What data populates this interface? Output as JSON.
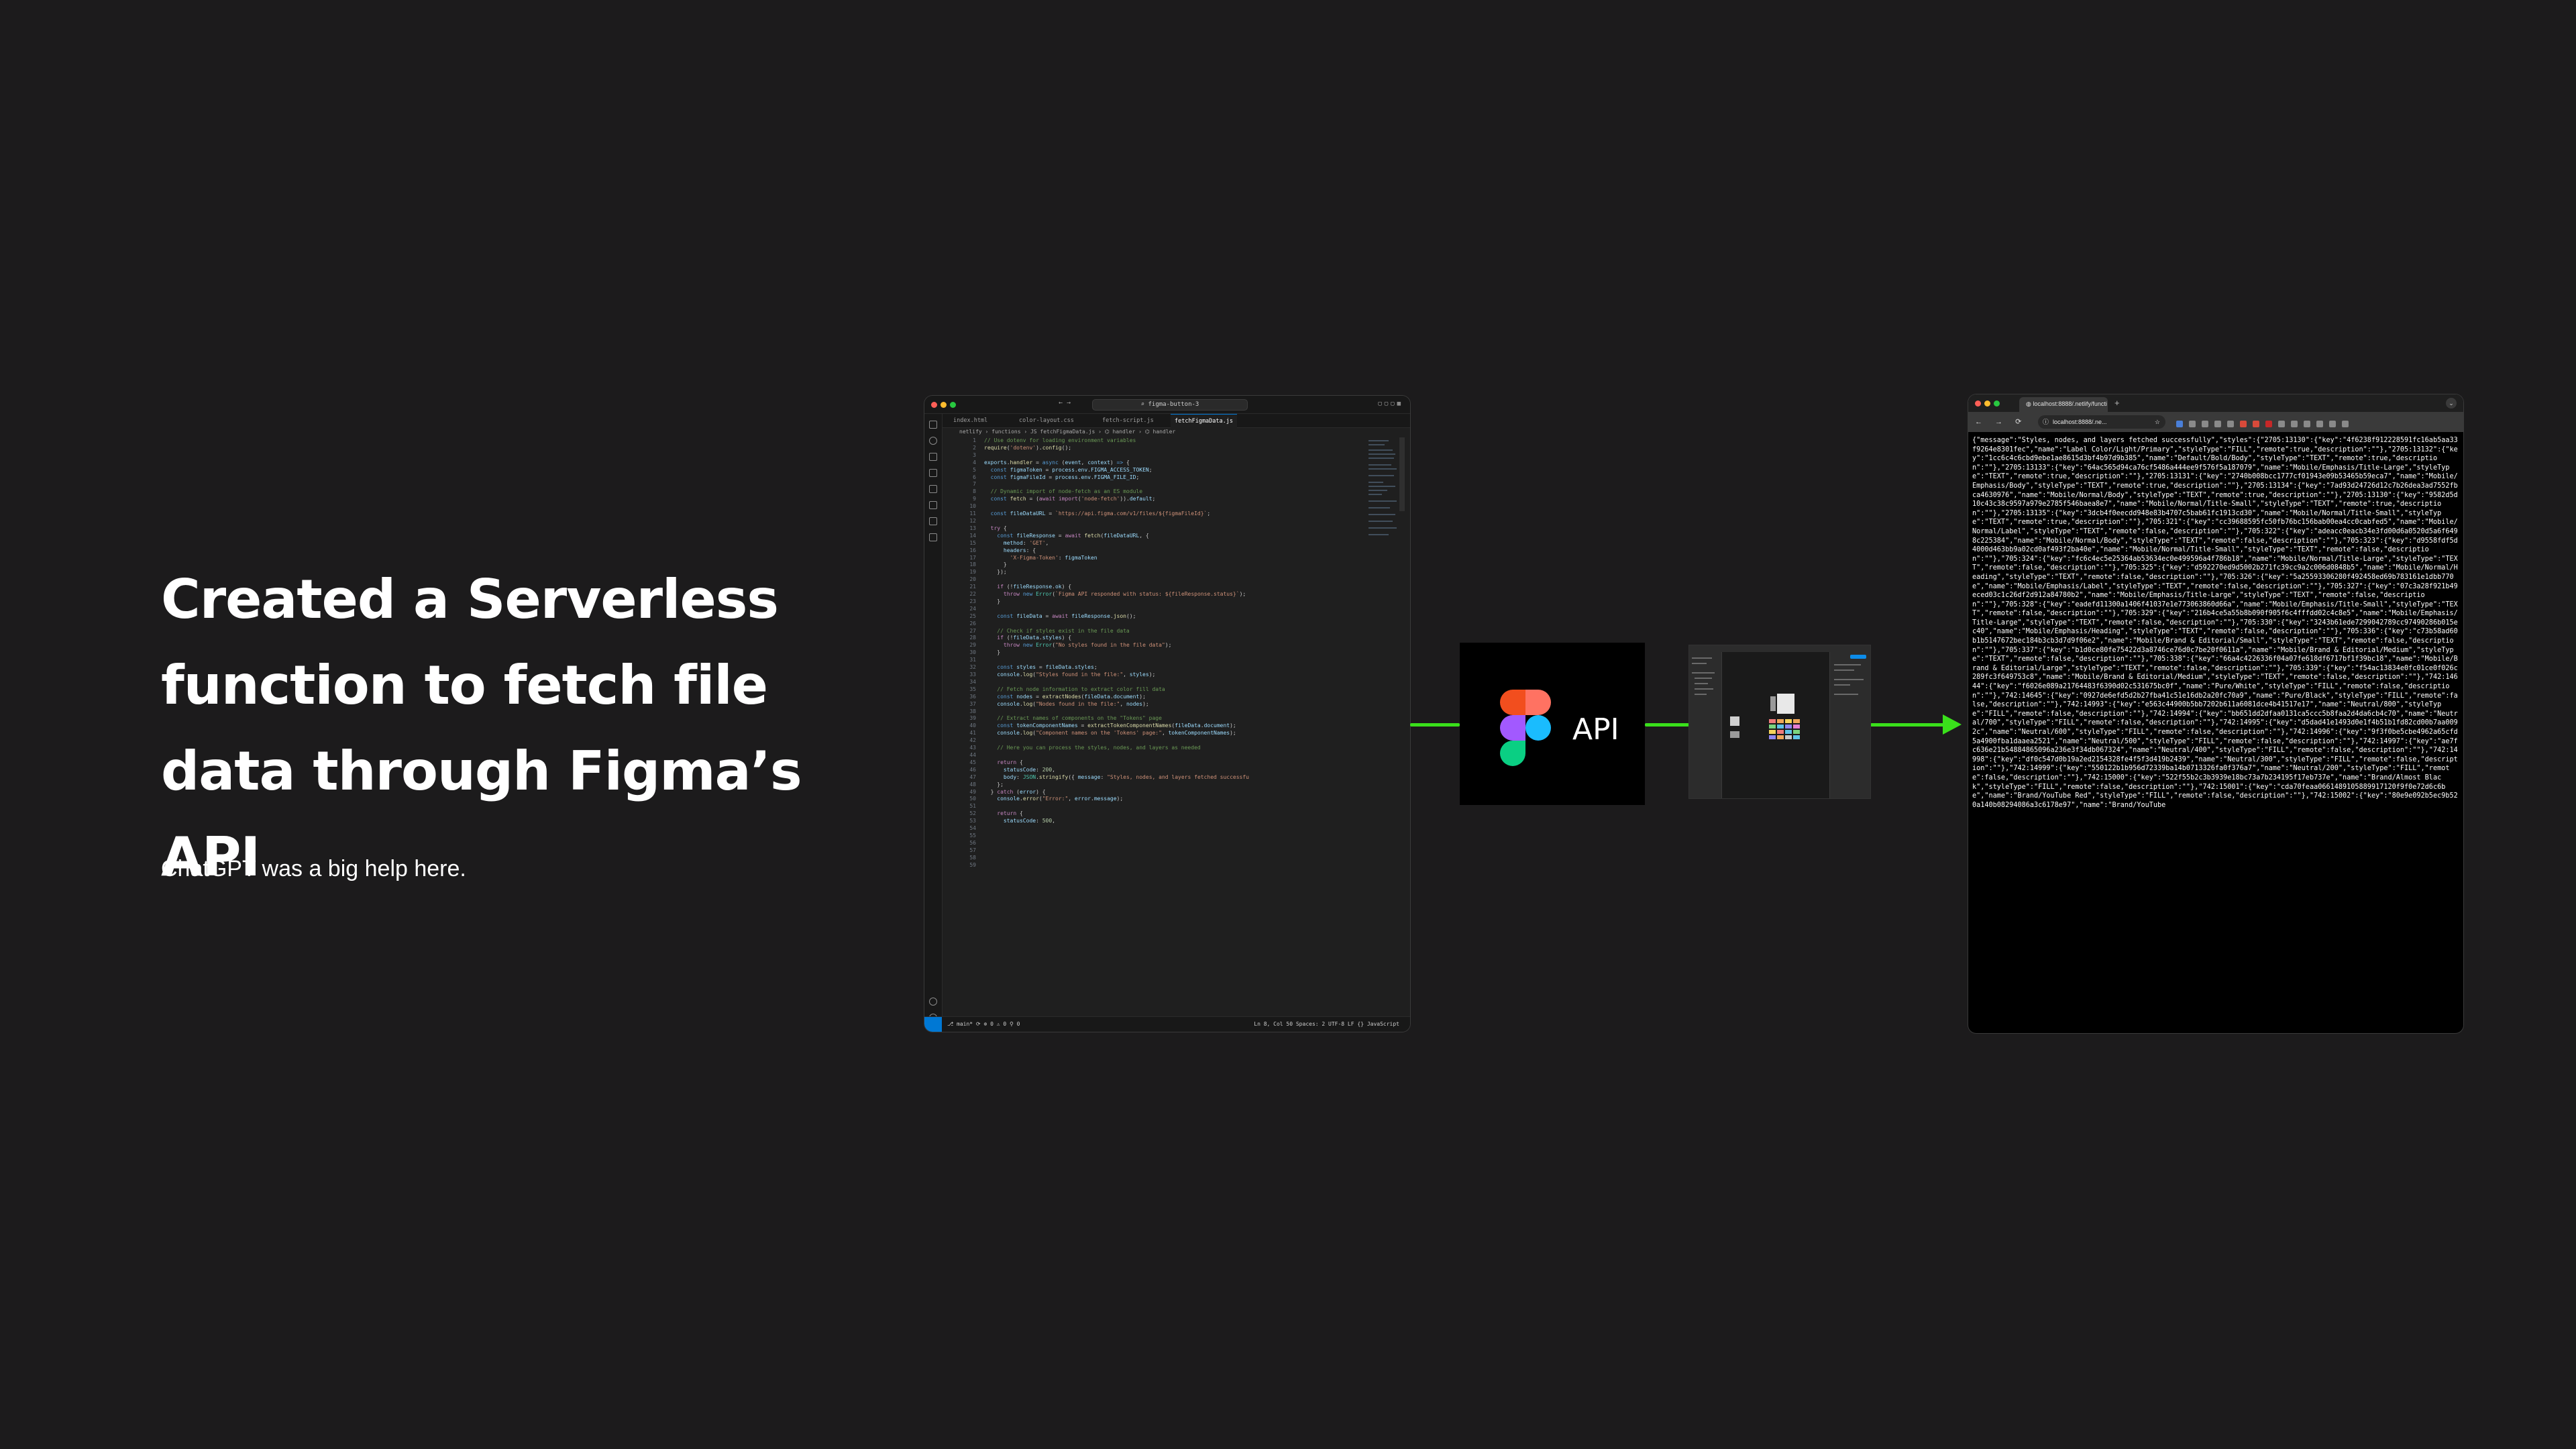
{
  "slide": {
    "title": "Created a Serverless function to fetch file data through Figma’s API",
    "subtitle": "ChatGPT was a big help here."
  },
  "vscode": {
    "search": "figma-button-3",
    "tabs": [
      "index.html",
      "color-layout.css",
      "fetch-script.js",
      "fetchFigmaData.js"
    ],
    "breadcrumb": "netlify › functions › JS fetchFigmaData.js › ⌬ handler › ⌬ handler",
    "line_numbers": "1\n2\n3\n4\n5\n6\n7\n8\n9\n10\n11\n12\n13\n14\n15\n16\n17\n18\n19\n20\n21\n22\n23\n24\n25\n26\n27\n28\n29\n30\n31\n32\n33\n34\n35\n36\n37\n38\n39\n40\n41\n42\n43\n44\n45\n46\n47\n48\n49\n50\n51\n52\n53\n54\n55\n56\n57\n58\n59",
    "status_left": "⎇ main*  ⟳  ⊗ 0 ⚠ 0  ⚲ 0",
    "status_right": "Ln 8, Col 50   Spaces: 2   UTF-8   LF   {} JavaScript"
  },
  "api_box": {
    "label": "API",
    "logo_colors": [
      "#f24e1e",
      "#ff7262",
      "#a259ff",
      "#1abcfe",
      "#0acf83"
    ]
  },
  "browser": {
    "tab_title": "localhost:8888/.netlify/functi",
    "url": "localhost:8888/.ne...",
    "json_output": "{\"message\":\"Styles, nodes, and layers fetched successfully\",\"styles\":{\"2705:13130\":{\"key\":\"4f6238f912228591fc16ab5aa33f9264e8301fec\",\"name\":\"Label Color/Light/Primary\",\"styleType\":\"FILL\",\"remote\":true,\"description\":\"\"},\"2705:13132\":{\"key\":\"1cc6c4c6cbd9ebe1ae8615d3bf4b97d9b385\",\"name\":\"Default/Bold/Body\",\"styleType\":\"TEXT\",\"remote\":true,\"description\":\"\"},\"2705:13133\":{\"key\":\"64ac565d94ca76cf5486a444ee9f576f5a187079\",\"name\":\"Mobile/Emphasis/Title-Large\",\"styleType\":\"TEXT\",\"remote\":true,\"description\":\"\"},\"2705:13131\":{\"key\":\"2740b008bcc1777cf01943e09b53465b59eca7\",\"name\":\"Mobile/Emphasis/Body\",\"styleType\":\"TEXT\",\"remote\":true,\"description\":\"\"},\"2705:13134\":{\"key\":\"7ad93d24726d12c7b26dea3ad7552fbca4630976\",\"name\":\"Mobile/Normal/Body\",\"styleType\":\"TEXT\",\"remote\":true,\"description\":\"\"},\"2705:13130\":{\"key\":\"9582d5d10c43c38c9597a979e2785f546baea8e7\",\"name\":\"Mobile/Normal/Title-Small\",\"styleType\":\"TEXT\",\"remote\":true,\"description\":\"\"},\"2705:13135\":{\"key\":\"3dcb4f0eecdd948e83b4707c5bab61fc1913cd30\",\"name\":\"Mobile/Normal/Title-Small\",\"styleType\":\"TEXT\",\"remote\":true,\"description\":\"\"},\"705:321\":{\"key\":\"cc39688595fc50fb76bc156bab00ea4cc0cabfed5\",\"name\":\"Mobile/Normal/Label\",\"styleType\":\"TEXT\",\"remote\":false,\"description\":\"\"},\"705:322\":{\"key\":\"adeacc0eacb34e3fd00d6a0520d5a6f6498c225384\",\"name\":\"Mobile/Normal/Body\",\"styleType\":\"TEXT\",\"remote\":false,\"description\":\"\"},\"705:323\":{\"key\":\"d9558fdf5d4000d463bb9a02cd0af493f2ba40e\",\"name\":\"Mobile/Normal/Title-Small\",\"styleType\":\"TEXT\",\"remote\":false,\"description\":\"\"},\"705:324\":{\"key\":\"fc6c4ec5e25364ab53634ec0e499596a4f786b18\",\"name\":\"Mobile/Normal/Title-Large\",\"styleType\":\"TEXT\",\"remote\":false,\"description\":\"\"},\"705:325\":{\"key\":\"d592270ed9d5002b271fc39cc9a2c006d0848b5\",\"name\":\"Mobile/Normal/Heading\",\"styleType\":\"TEXT\",\"remote\":false,\"description\":\"\"},\"705:326\":{\"key\":\"5a25593306280f492458ed69b783161e1dbb770e\",\"name\":\"Mobile/Emphasis/Label\",\"styleType\":\"TEXT\",\"remote\":false,\"description\":\"\"},\"705:327\":{\"key\":\"07c3a28f921b49eced03c1c26df2d912a84780b2\",\"name\":\"Mobile/Emphasis/Title-Large\",\"styleType\":\"TEXT\",\"remote\":false,\"description\":\"\"},\"705:328\":{\"key\":\"eadefd11300a1406f41037e1e773063860d66a\",\"name\":\"Mobile/Emphasis/Title-Small\",\"styleType\":\"TEXT\",\"remote\":false,\"description\":\"\"},\"705:329\":{\"key\":\"216b4ce5a55b8b090f905f6c4fffdd02c4c8e5\",\"name\":\"Mobile/Emphasis/Title-Large\",\"styleType\":\"TEXT\",\"remote\":false,\"description\":\"\"},\"705:330\":{\"key\":\"3243b61ede7299042789cc97490286b015ec40\",\"name\":\"Mobile/Emphasis/Heading\",\"styleType\":\"TEXT\",\"remote\":false,\"description\":\"\"},\"705:336\":{\"key\":\"c73b58ad60b1b5147672bec184b3cb3d7d9f06e2\",\"name\":\"Mobile/Brand & Editorial/Small\",\"styleType\":\"TEXT\",\"remote\":false,\"description\":\"\"},\"705:337\":{\"key\":\"b1d0ce80fe75422d3a8746ce76d0c7be20f0611a\",\"name\":\"Mobile/Brand & Editorial/Medium\",\"styleType\":\"TEXT\",\"remote\":false,\"description\":\"\"},\"705:338\":{\"key\":\"66a4c4226336f04a07fe618df6717bf1f39bc18\",\"name\":\"Mobile/Brand & Editorial/Large\",\"styleType\":\"TEXT\",\"remote\":false,\"description\":\"\"},\"705:339\":{\"key\":\"f54ac13834e0fc01ce0f026c289fc3f649753c8\",\"name\":\"Mobile/Brand & Editorial/Medium\",\"styleType\":\"TEXT\",\"remote\":false,\"description\":\"\"},\"742:14644\":{\"key\":\"f6026e089a21764483f6390d02c531675bc0f\",\"name\":\"Pure/White\",\"styleType\":\"FILL\",\"remote\":false,\"description\":\"\"},\"742:14645\":{\"key\":\"0927de6efd5d2b27fba41c51e16db2a20fc70a9\",\"name\":\"Pure/Black\",\"styleType\":\"FILL\",\"remote\":false,\"description\":\"\"},\"742:14993\":{\"key\":\"e563c44900b5bb7202b611a6081dce4b41517e17\",\"name\":\"Neutral/800\",\"styleType\":\"FILL\",\"remote\":false,\"description\":\"\"},\"742:14994\":{\"key\":\"bb651dd2dfaa0131ca5ccc5b8faa2d4da6cb4c70\",\"name\":\"Neutral/700\",\"styleType\":\"FILL\",\"remote\":false,\"description\":\"\"},\"742:14995\":{\"key\":\"d5dad41e1493d0e1f4b51b1fd82cd00b7aa0092c\",\"name\":\"Neutral/600\",\"styleType\":\"FILL\",\"remote\":false,\"description\":\"\"},\"742:14996\":{\"key\":\"9f3f0be5cbe4962a65cfd5a4900fba1daaea2521\",\"name\":\"Neutral/500\",\"styleType\":\"FILL\",\"remote\":false,\"description\":\"\"},\"742:14997\":{\"key\":\"ae7fc636e21b54884865096a236e3f34db067324\",\"name\":\"Neutral/400\",\"styleType\":\"FILL\",\"remote\":false,\"description\":\"\"},\"742:14998\":{\"key\":\"df0c547d0b19a2ed2154328fe4f5f3d419b2439\",\"name\":\"Neutral/300\",\"styleType\":\"FILL\",\"remote\":false,\"description\":\"\"},\"742:14999\":{\"key\":\"550122b1b956d72339ba14b0713326fa0f376a7\",\"name\":\"Neutral/200\",\"styleType\":\"FILL\",\"remote\":false,\"description\":\"\"},\"742:15000\":{\"key\":\"522f55b2c3b3939e18bc73a7b234195f17eb737e\",\"name\":\"Brand/Almost Black\",\"styleType\":\"FILL\",\"remote\":false,\"description\":\"\"},\"742:15001\":{\"key\":\"cda70feaa0661489105889917120f9f0e72d6c6be\",\"name\":\"Brand/YouTube Red\",\"styleType\":\"FILL\",\"remote\":false,\"description\":\"\"},\"742:15002\":{\"key\":\"80e9e092b5ec9b520a140b08294086a3c6178e97\",\"name\":\"Brand/YouTube"
  },
  "icons": {
    "arrow_color": "#3ae01b"
  }
}
